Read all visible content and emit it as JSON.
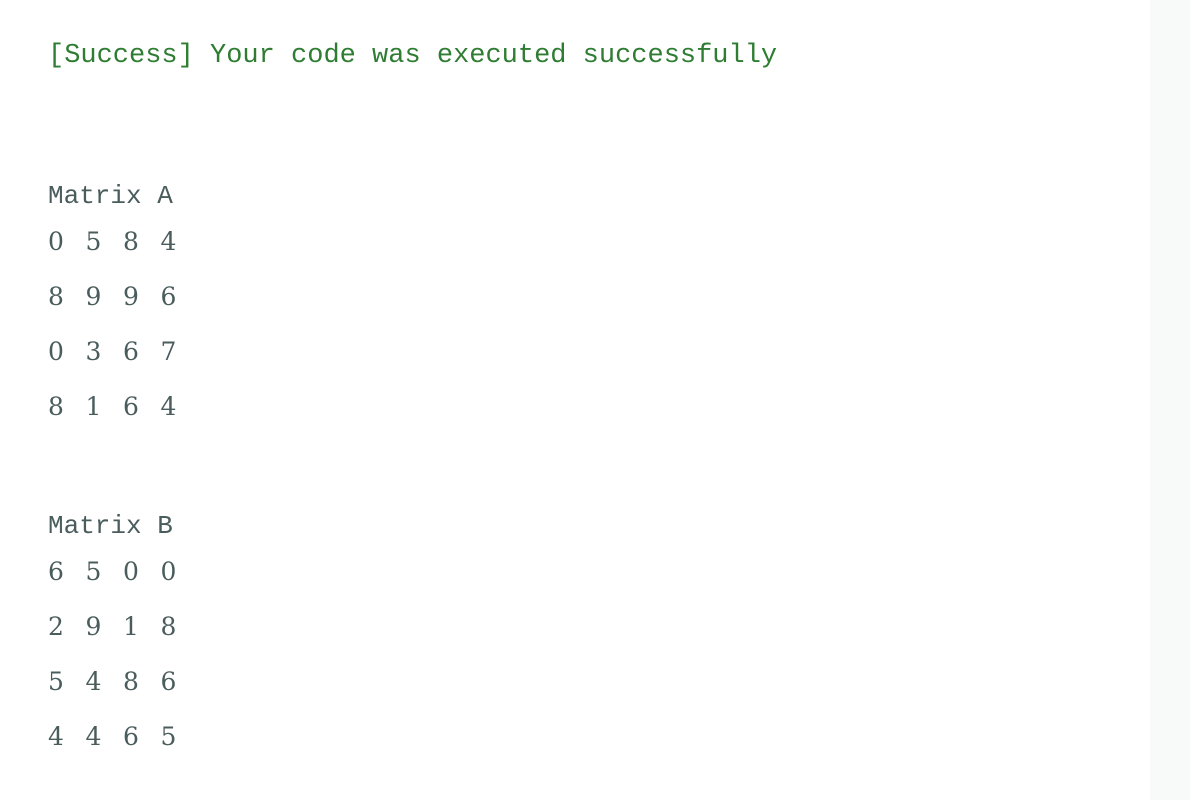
{
  "output": {
    "status": "[Success] Your code was executed successfully",
    "status_color": "#2e7d32",
    "text_color": "#4a5c5c",
    "matrices": [
      {
        "title": "Matrix A",
        "rows": [
          [
            "0",
            "5",
            "8",
            "4"
          ],
          [
            "8",
            "9",
            "9",
            "6"
          ],
          [
            "0",
            "3",
            "6",
            "7"
          ],
          [
            "8",
            "1",
            "6",
            "4"
          ]
        ]
      },
      {
        "title": "Matrix B",
        "rows": [
          [
            "6",
            "5",
            "0",
            "0"
          ],
          [
            "2",
            "9",
            "1",
            "8"
          ],
          [
            "5",
            "4",
            "8",
            "6"
          ],
          [
            "4",
            "4",
            "6",
            "5"
          ]
        ]
      }
    ]
  }
}
